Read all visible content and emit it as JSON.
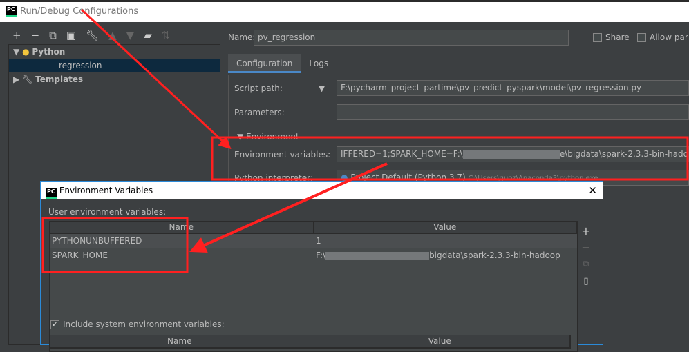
{
  "window": {
    "title": "Run/Debug Configurations",
    "logo": "PC"
  },
  "toolbar": {
    "icons": [
      "plus-icon",
      "minus-icon",
      "copy-icon",
      "save-icon",
      "wrench-icon",
      "arrow-up-icon",
      "arrow-down-icon",
      "folder-add-icon",
      "sort-icon"
    ]
  },
  "tree": {
    "python": "Python",
    "item": "regression",
    "templates": "Templates"
  },
  "form": {
    "name_label": "Name:",
    "name_value": "pv_regression",
    "share": "Share",
    "allow_parallel": "Allow par",
    "tabs": [
      "Configuration",
      "Logs"
    ],
    "script_label": "Script path:",
    "script_value": "F:\\pycharm_project_partime\\pv_predict_pyspark\\model\\pv_regression.py",
    "params_label": "Parameters:",
    "params_value": "",
    "env_section": "Environment",
    "env_label": "Environment variables:",
    "env_value_start": "IFFERED=1;SPARK_HOME=F:\\",
    "env_value_end": "e\\bigdata\\spark-2.3.3-bin-hadoop",
    "interp_label": "Python interpreter:",
    "interp_value": "Project Default (Python 3.7)",
    "interp_path": "C:\\Users\\guoz\\Anaconda3\\python.exe"
  },
  "dialog": {
    "title": "Environment Variables",
    "logo": "PC",
    "user_label": "User environment variables:",
    "columns": [
      "Name",
      "Value"
    ],
    "rows": [
      {
        "name": "PYTHONUNBUFFERED",
        "value_start": "1",
        "value_end": ""
      },
      {
        "name": "SPARK_HOME",
        "value_start": "F:\\",
        "value_end": "bigdata\\spark-2.3.3-bin-hadoop"
      }
    ],
    "include_system": "Include system environment variables:",
    "include_checked": true,
    "system_columns": [
      "Name",
      "Value"
    ]
  },
  "annotation_color": "#ff2020"
}
